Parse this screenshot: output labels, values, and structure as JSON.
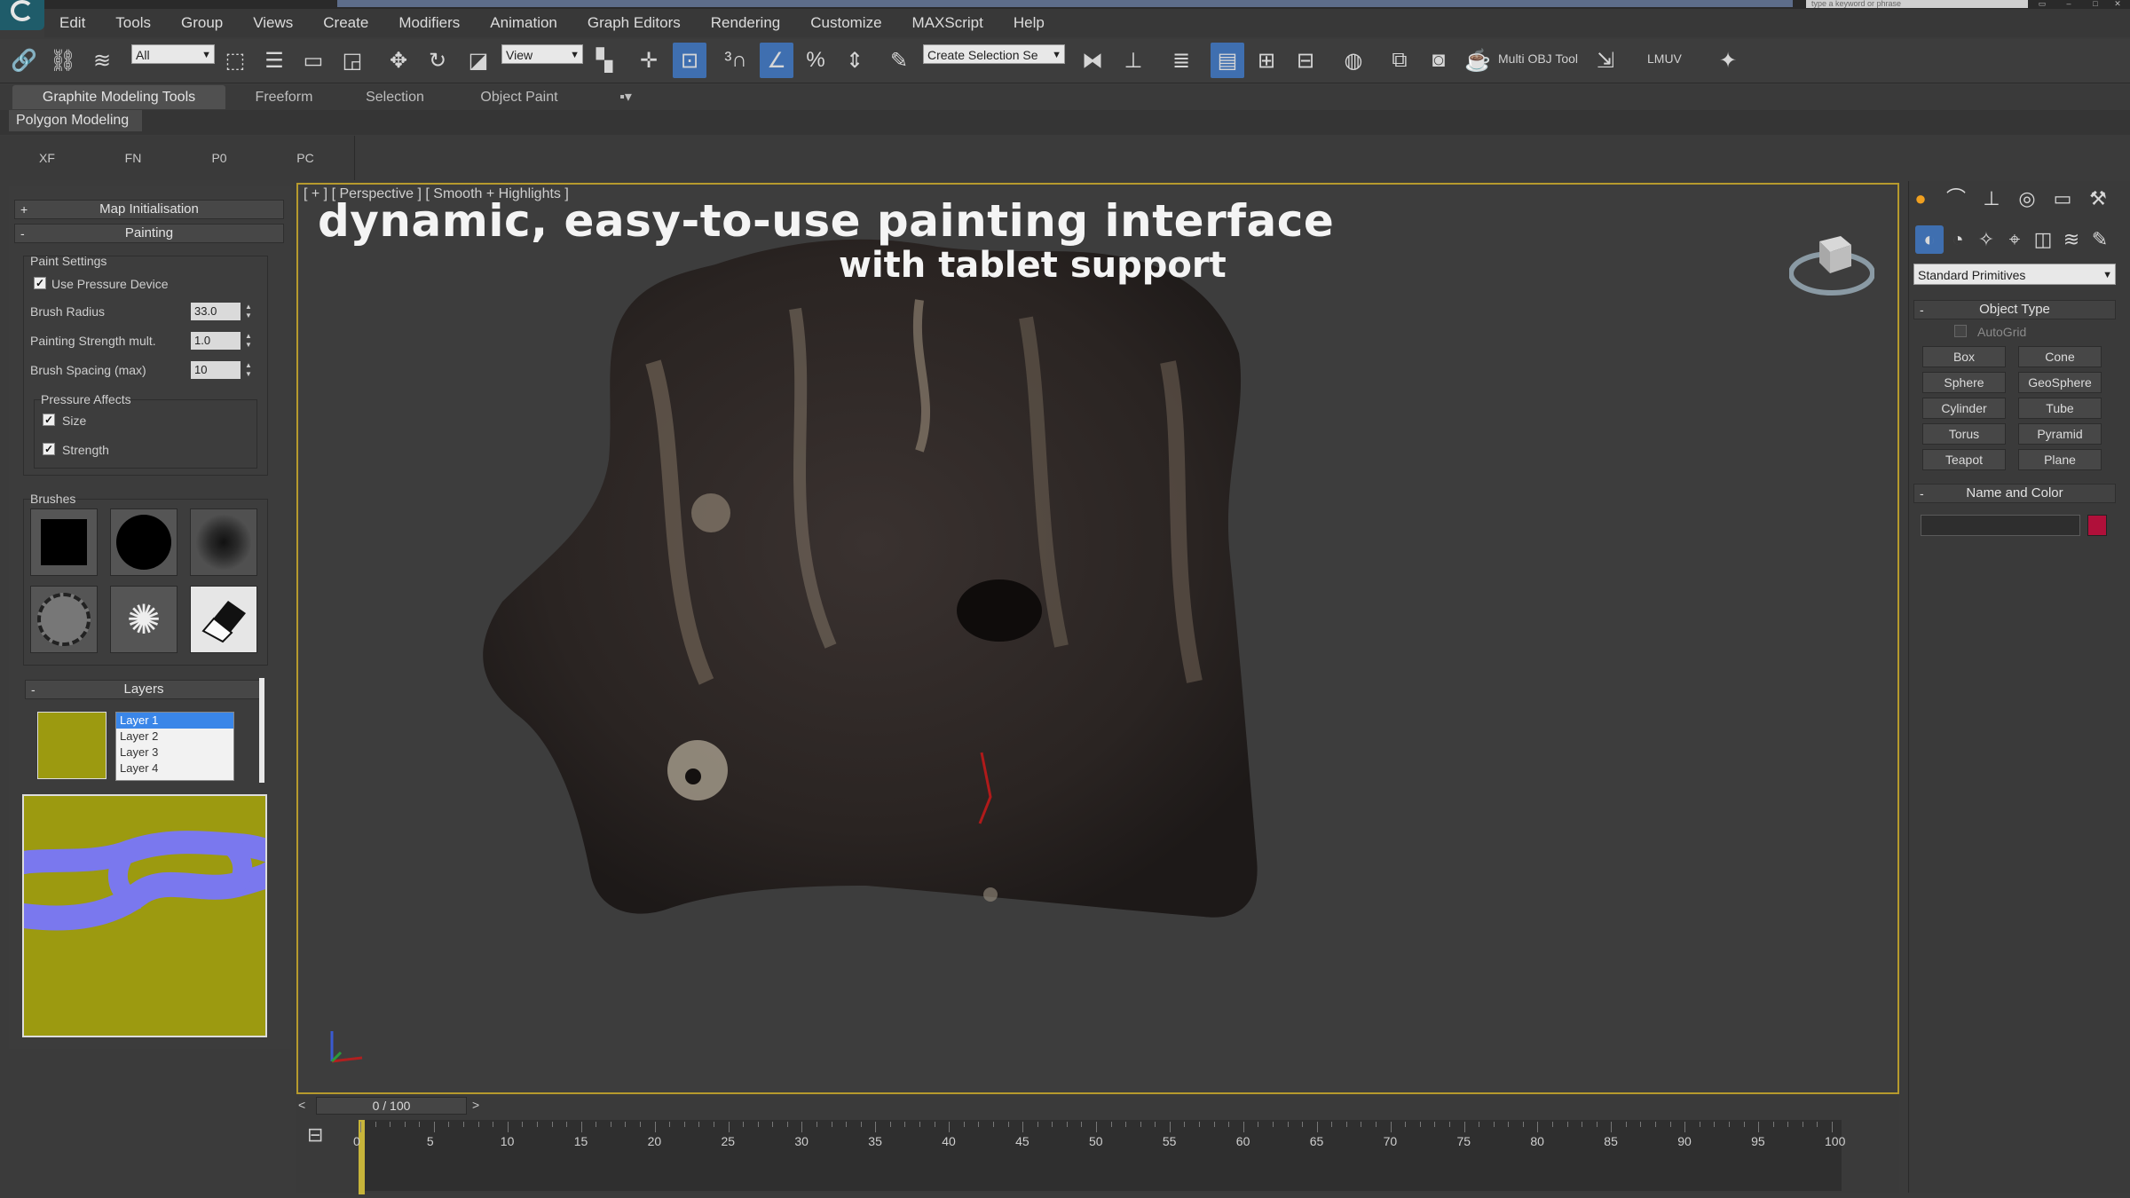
{
  "titlebar": {
    "search_placeholder": "type a keyword or phrase"
  },
  "menu": [
    "Edit",
    "Tools",
    "Group",
    "Views",
    "Create",
    "Modifiers",
    "Animation",
    "Graph Editors",
    "Rendering",
    "Customize",
    "MAXScript",
    "Help"
  ],
  "toolbar": {
    "selection_filter": "All",
    "ref_coord": "View",
    "named_selection": "Create Selection Se",
    "multi_obj_tool": "Multi OBJ Tool",
    "lmuv": "LMUV"
  },
  "ribbon": {
    "tabs": [
      "Graphite Modeling Tools",
      "Freeform",
      "Selection",
      "Object Paint"
    ],
    "panel": "Polygon Modeling"
  },
  "subtabs": [
    "XF",
    "FN",
    "P0",
    "PC"
  ],
  "left": {
    "map_init": "Map Initialisation",
    "painting": "Painting",
    "paint_settings": "Paint Settings",
    "use_pressure": "Use Pressure Device",
    "brush_radius_label": "Brush Radius",
    "brush_radius": "33.0",
    "strength_label": "Painting Strength mult.",
    "strength": "1.0",
    "spacing_label": "Brush Spacing (max)",
    "spacing": "10",
    "pressure_affects": "Pressure Affects",
    "size": "Size",
    "strength_chk": "Strength",
    "brushes": "Brushes",
    "layers_title": "Layers",
    "layers": [
      "Layer 1",
      "Layer 2",
      "Layer 3",
      "Layer 4"
    ]
  },
  "viewport": {
    "label": "[ + ] [ Perspective ] [ Smooth + Highlights ]",
    "headline": "dynamic, easy-to-use painting interface",
    "subline": "with tablet support"
  },
  "right": {
    "dropdown": "Standard Primitives",
    "object_type": "Object Type",
    "autogrid": "AutoGrid",
    "primitives": [
      "Box",
      "Cone",
      "Sphere",
      "GeoSphere",
      "Cylinder",
      "Tube",
      "Torus",
      "Pyramid",
      "Teapot",
      "Plane"
    ],
    "name_color": "Name and Color",
    "swatch_color": "#b0103a"
  },
  "timeline": {
    "frame": "0 / 100",
    "ticks": [
      "0",
      "5",
      "10",
      "15",
      "20",
      "25",
      "30",
      "35",
      "40",
      "45",
      "50",
      "55",
      "60",
      "65",
      "70",
      "75",
      "80",
      "85",
      "90",
      "95",
      "100"
    ]
  },
  "colors": {
    "accent": "#3f6fb0",
    "viewport_border": "#b69a2d",
    "layer_bg": "#9c9a10",
    "stroke": "#7a78ee"
  }
}
